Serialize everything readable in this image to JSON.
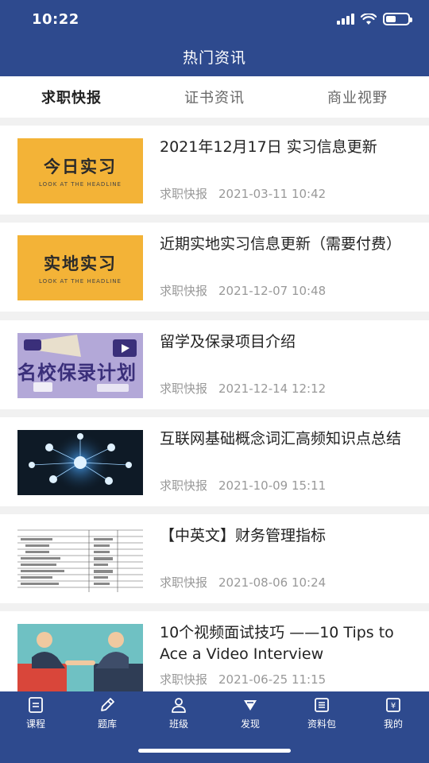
{
  "status": {
    "time": "10:22"
  },
  "header": {
    "title": "热门资讯"
  },
  "tabs": [
    {
      "label": "求职快报",
      "active": true
    },
    {
      "label": "证书资讯",
      "active": false
    },
    {
      "label": "商业视野",
      "active": false
    }
  ],
  "articles": [
    {
      "title": "2021年12月17日 实习信息更新",
      "category": "求职快报",
      "date": "2021-03-11 10:42",
      "thumb_text": "今日实习",
      "thumb_sub": "LOOK AT THE HEADLINE"
    },
    {
      "title": "近期实地实习信息更新（需要付费）",
      "category": "求职快报",
      "date": "2021-12-07 10:48",
      "thumb_text": "实地实习",
      "thumb_sub": "LOOK AT THE HEADLINE"
    },
    {
      "title": "留学及保录项目介绍",
      "category": "求职快报",
      "date": "2021-12-14 12:12",
      "thumb_text": "名校保录计划"
    },
    {
      "title": "互联网基础概念词汇高频知识点总结",
      "category": "求职快报",
      "date": "2021-10-09 15:11"
    },
    {
      "title": "【中英文】财务管理指标",
      "category": "求职快报",
      "date": "2021-08-06 10:24"
    },
    {
      "title": "10个视频面试技巧 ——10 Tips to Ace a Video Interview",
      "category": "求职快报",
      "date": "2021-06-25 11:15"
    }
  ],
  "bottom_nav": [
    {
      "label": "课程",
      "icon": "course-icon"
    },
    {
      "label": "题库",
      "icon": "pencil-icon"
    },
    {
      "label": "班级",
      "icon": "person-icon"
    },
    {
      "label": "发现",
      "icon": "discover-icon"
    },
    {
      "label": "资料包",
      "icon": "list-icon"
    },
    {
      "label": "我的",
      "icon": "wallet-icon"
    }
  ],
  "colors": {
    "primary": "#2e4a8e",
    "thumb_yellow": "#f3b337"
  }
}
